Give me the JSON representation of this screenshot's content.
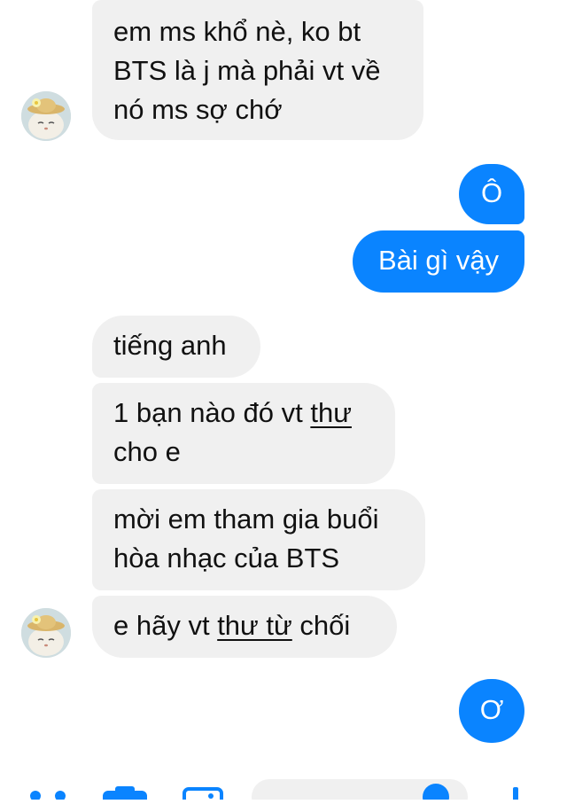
{
  "messages": [
    {
      "id": "m1",
      "sender": "other",
      "lines": [
        "em ms khổ nè, ko bt",
        "BTS là j mà phải vt về",
        "nó ms sợ chớ"
      ]
    },
    {
      "id": "m2",
      "sender": "me",
      "text": "Ô"
    },
    {
      "id": "m3",
      "sender": "me",
      "text": "Bài gì vậy"
    },
    {
      "id": "m4",
      "sender": "other",
      "text": "tiếng anh"
    },
    {
      "id": "m5",
      "sender": "other",
      "line1_a": "1 bạn nào đó vt ",
      "line1_link": "thư",
      "line2": "cho e"
    },
    {
      "id": "m6",
      "sender": "other",
      "lines": [
        "mời em tham gia buổi",
        "hòa nhạc của BTS"
      ]
    },
    {
      "id": "m7",
      "sender": "other",
      "a": "e hãy vt ",
      "link": "thư từ",
      "b": " chối"
    },
    {
      "id": "m8",
      "sender": "me",
      "text": "Ơ"
    }
  ],
  "icons": {
    "avatar": "cat-with-hat-avatar",
    "composer": [
      "dots-icon",
      "camera-icon",
      "gallery-icon",
      "message-input",
      "emoji-icon",
      "like-icon"
    ]
  },
  "colors": {
    "outgoing": "#0a84ff",
    "incoming": "#f0f0f0"
  }
}
